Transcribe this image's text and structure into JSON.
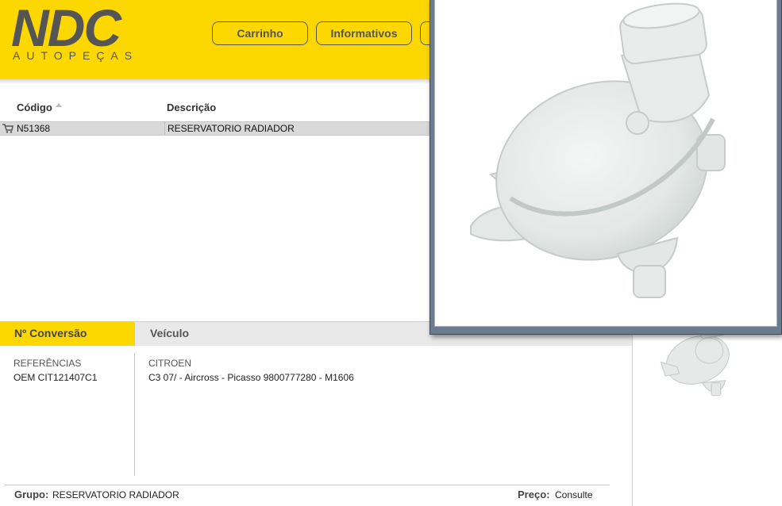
{
  "brand": {
    "logo_text": "NDC",
    "sub_text": "AUTOPEÇAS"
  },
  "nav": {
    "cart_label": "Carrinho",
    "info_label": "Informativos"
  },
  "grid": {
    "columns": [
      "Código",
      "Descrição"
    ],
    "rows": [
      {
        "code": "N51368",
        "description": "RESERVATORIO RADIADOR"
      }
    ]
  },
  "tabs": [
    {
      "label": "Nº Conversão",
      "active": true
    },
    {
      "label": "Veículo",
      "active": false
    }
  ],
  "details": {
    "references_label": "REFERÊNCIAS",
    "reference_value": "OEM CIT121407C1",
    "vehicle_make": "CITROEN",
    "vehicle_models": "C3 07/ - Aircross - Picasso 9800777280 - M1606"
  },
  "footer": {
    "group_label": "Grupo:",
    "group_value": "RESERVATORIO RADIADOR",
    "price_label": "Preço:",
    "price_value": "Consulte"
  },
  "colors": {
    "brand_yellow": "#fdd800",
    "logo_gray": "#555555"
  }
}
